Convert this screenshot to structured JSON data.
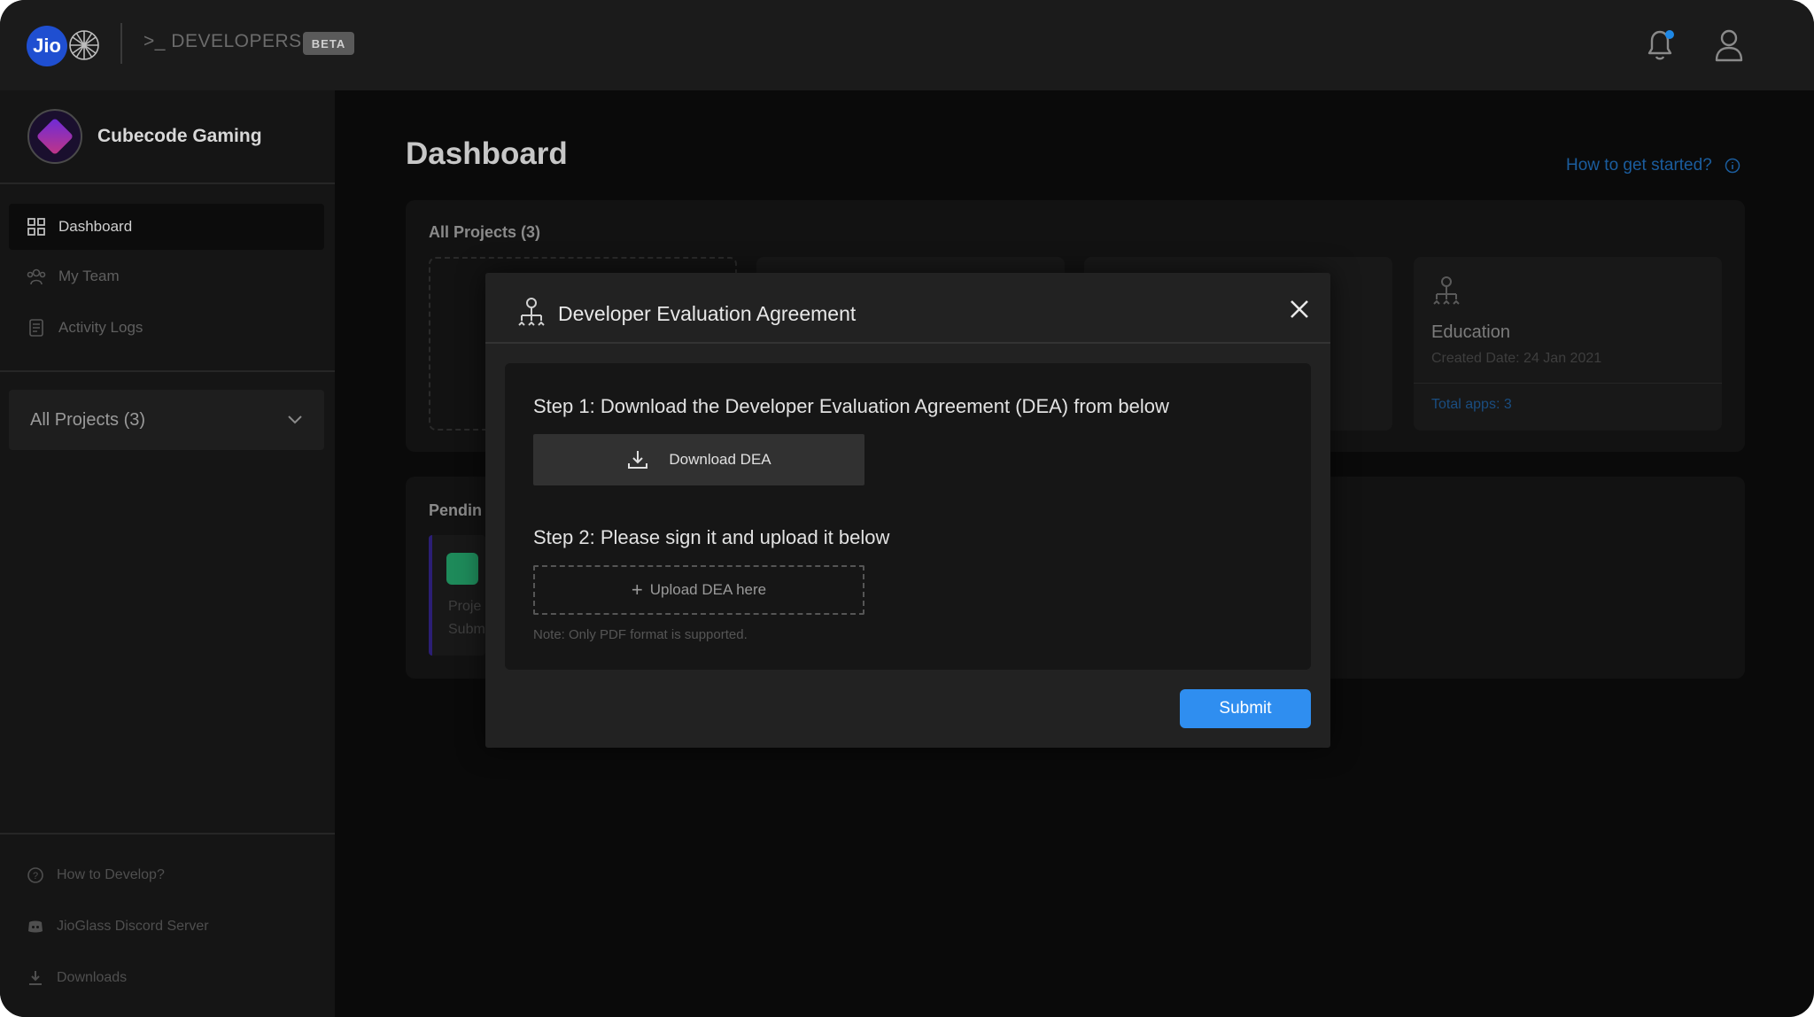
{
  "header": {
    "logo_text": "Jio",
    "developers_label": ">_ DEVELOPERS",
    "beta_badge": "BETA"
  },
  "sidebar": {
    "org_name": "Cubecode Gaming",
    "nav": [
      {
        "label": "Dashboard",
        "icon": "grid-icon",
        "active": true
      },
      {
        "label": "My Team",
        "icon": "team-icon",
        "active": false
      },
      {
        "label": "Activity Logs",
        "icon": "logs-icon",
        "active": false
      }
    ],
    "projects_dropdown": "All Projects (3)",
    "bottom": [
      {
        "label": "How to Develop?",
        "icon": "help-circle-icon"
      },
      {
        "label": "JioGlass Discord Server",
        "icon": "discord-icon"
      },
      {
        "label": "Downloads",
        "icon": "download-icon"
      }
    ]
  },
  "main": {
    "title": "Dashboard",
    "help_link": "How to get started?",
    "all_projects": {
      "title": "All Projects (3)",
      "visible_card": {
        "name": "Education",
        "created": "Created Date: 24 Jan 2021",
        "total_apps": "Total apps: 3"
      }
    },
    "pending": {
      "title_partial": "Pendin",
      "line1_partial": "Proje",
      "line2_partial": "Subm"
    }
  },
  "modal": {
    "title": "Developer Evaluation Agreement",
    "step1": "Step 1: Download the Developer Evaluation Agreement (DEA) from below",
    "download_button": "Download DEA",
    "step2": "Step 2: Please sign it and upload it below",
    "upload_label": "Upload DEA here",
    "note": "Note: Only PDF format is supported.",
    "submit": "Submit"
  },
  "colors": {
    "accent": "#2f8ef0",
    "link": "#1b5d9e",
    "background": "#0a0a0a"
  }
}
